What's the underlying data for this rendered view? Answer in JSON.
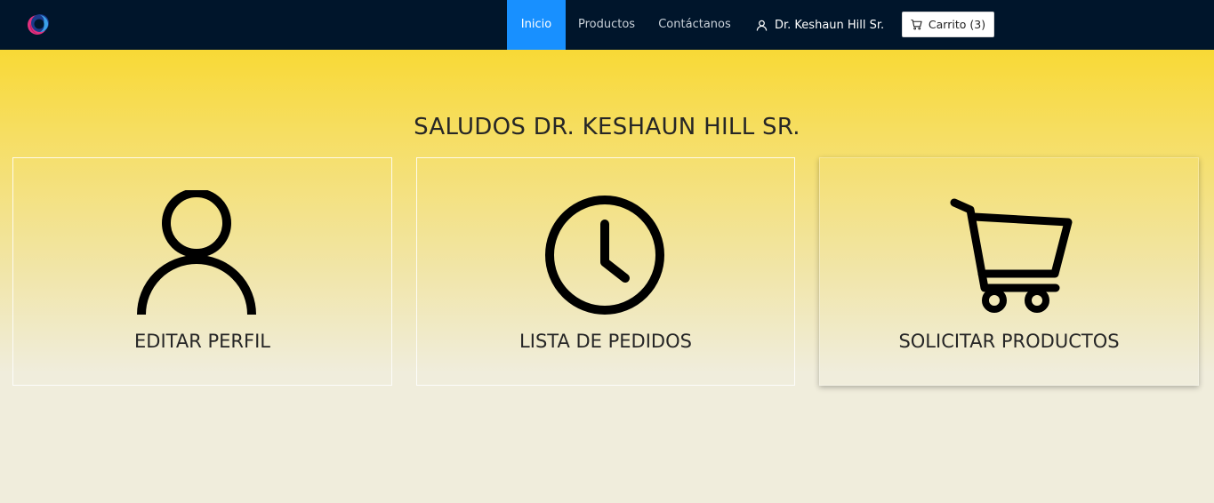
{
  "nav": {
    "items": [
      {
        "label": "Inicio",
        "active": true
      },
      {
        "label": "Productos",
        "active": false
      },
      {
        "label": "Contáctanos",
        "active": false
      }
    ],
    "user_name": "Dr. Keshaun Hill Sr.",
    "cart_label": "Carrito (3)",
    "active_color": "#1890ff",
    "bar_color": "#00152b"
  },
  "main": {
    "greeting": "SALUDOS DR. KESHAUN HILL SR.",
    "cards": [
      {
        "label": "EDITAR PERFIL",
        "icon": "user-icon"
      },
      {
        "label": "LISTA DE PEDIDOS",
        "icon": "clock-icon"
      },
      {
        "label": "SOLICITAR PRODUCTOS",
        "icon": "cart-icon"
      }
    ]
  },
  "colors": {
    "gradient_top": "#fad61b",
    "gradient_bottom": "#f0eddc"
  }
}
